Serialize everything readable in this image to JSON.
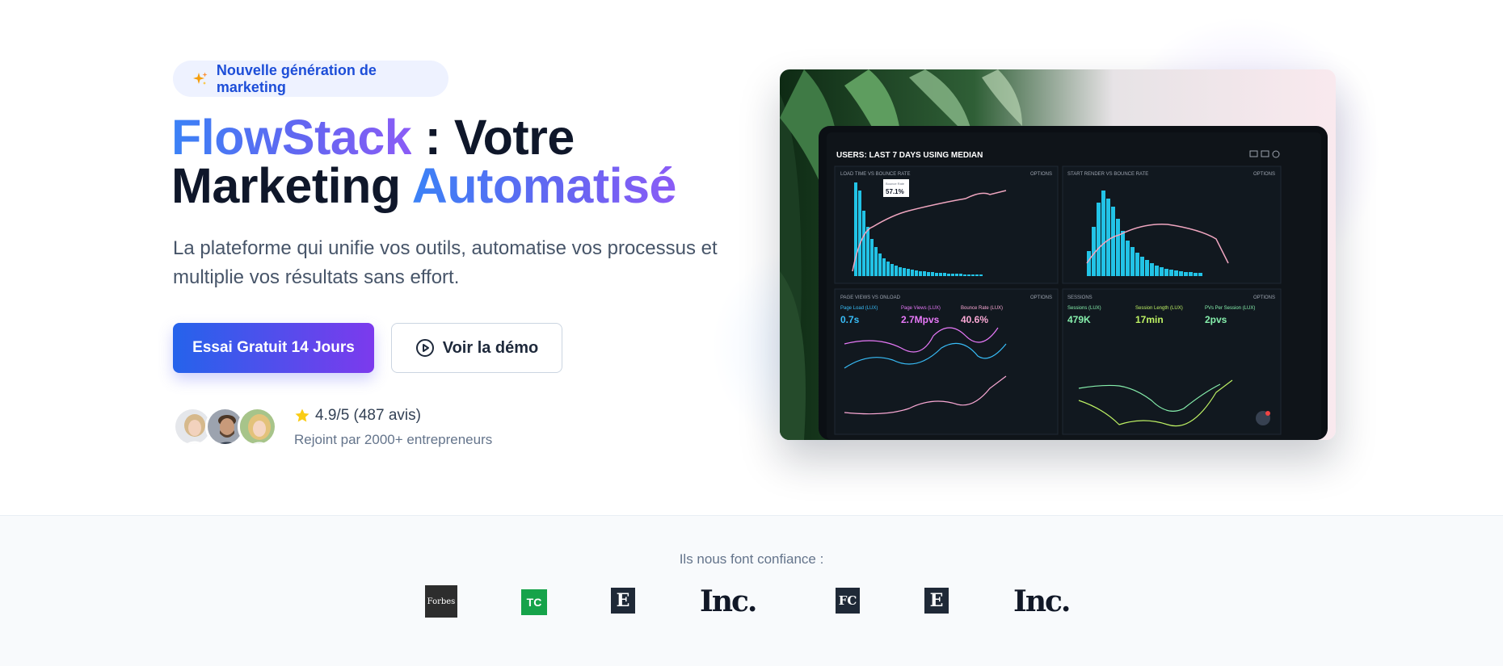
{
  "hero": {
    "badge": {
      "icon": "sparkles-icon",
      "text": "Nouvelle génération de marketing"
    },
    "title": {
      "brand": "FlowStack",
      "rest_line1": " : Votre",
      "line2_plain": "Marketing ",
      "line2_gradient": "Automatisé"
    },
    "subtitle": "La plateforme qui unifie vos outils, automatise vos processus et multiplie vos résultats sans effort.",
    "cta_primary": "Essai Gratuit 14 Jours",
    "cta_secondary": {
      "icon": "play-circle-icon",
      "label": "Voir la démo"
    },
    "rating": {
      "icon": "star-icon",
      "text": "4.9/5 (487 avis)"
    },
    "joined": "Rejoint par 2000+ entrepreneurs",
    "colors": {
      "gradient_start": "#3b82f6",
      "gradient_end": "#8b5cf6",
      "star": "#facc15"
    }
  },
  "dashboard": {
    "header": "USERS: LAST 7 DAYS USING MEDIAN",
    "panel1_title": "LOAD TIME VS BOUNCE RATE",
    "panel2_title": "START RENDER VS BOUNCE RATE",
    "options": "OPTIONS",
    "tooltip_label": "Bounce Rate",
    "tooltip_value": "57.1%",
    "panel3_title": "PAGE VIEWS VS ONLOAD",
    "panel4_title": "SESSIONS",
    "metrics": [
      {
        "label": "Page Load (LUX)",
        "value": "0.7s",
        "color": "#38bdf8"
      },
      {
        "label": "Page Views (LUX)",
        "value": "2.7Mpvs",
        "color": "#e879f9"
      },
      {
        "label": "Bounce Rate (LUX)",
        "value": "40.6%",
        "color": "#f9a8d4"
      },
      {
        "label": "Sessions (LUX)",
        "value": "479K",
        "color": "#86efac"
      },
      {
        "label": "Session Length (LUX)",
        "value": "17min",
        "color": "#bef264"
      },
      {
        "label": "PVs Per Session (LUX)",
        "value": "2pvs",
        "color": "#86efac"
      }
    ]
  },
  "trust": {
    "label": "Ils nous font confiance :",
    "logos": [
      {
        "name": "Forbes",
        "text": "Forbes"
      },
      {
        "name": "TechCrunch",
        "text": "TC"
      },
      {
        "name": "Entrepreneur",
        "text": "E"
      },
      {
        "name": "Inc",
        "text": "Inc."
      },
      {
        "name": "FastCompany",
        "text": "FC"
      },
      {
        "name": "Entrepreneur",
        "text": "E"
      },
      {
        "name": "Inc",
        "text": "Inc."
      }
    ]
  }
}
